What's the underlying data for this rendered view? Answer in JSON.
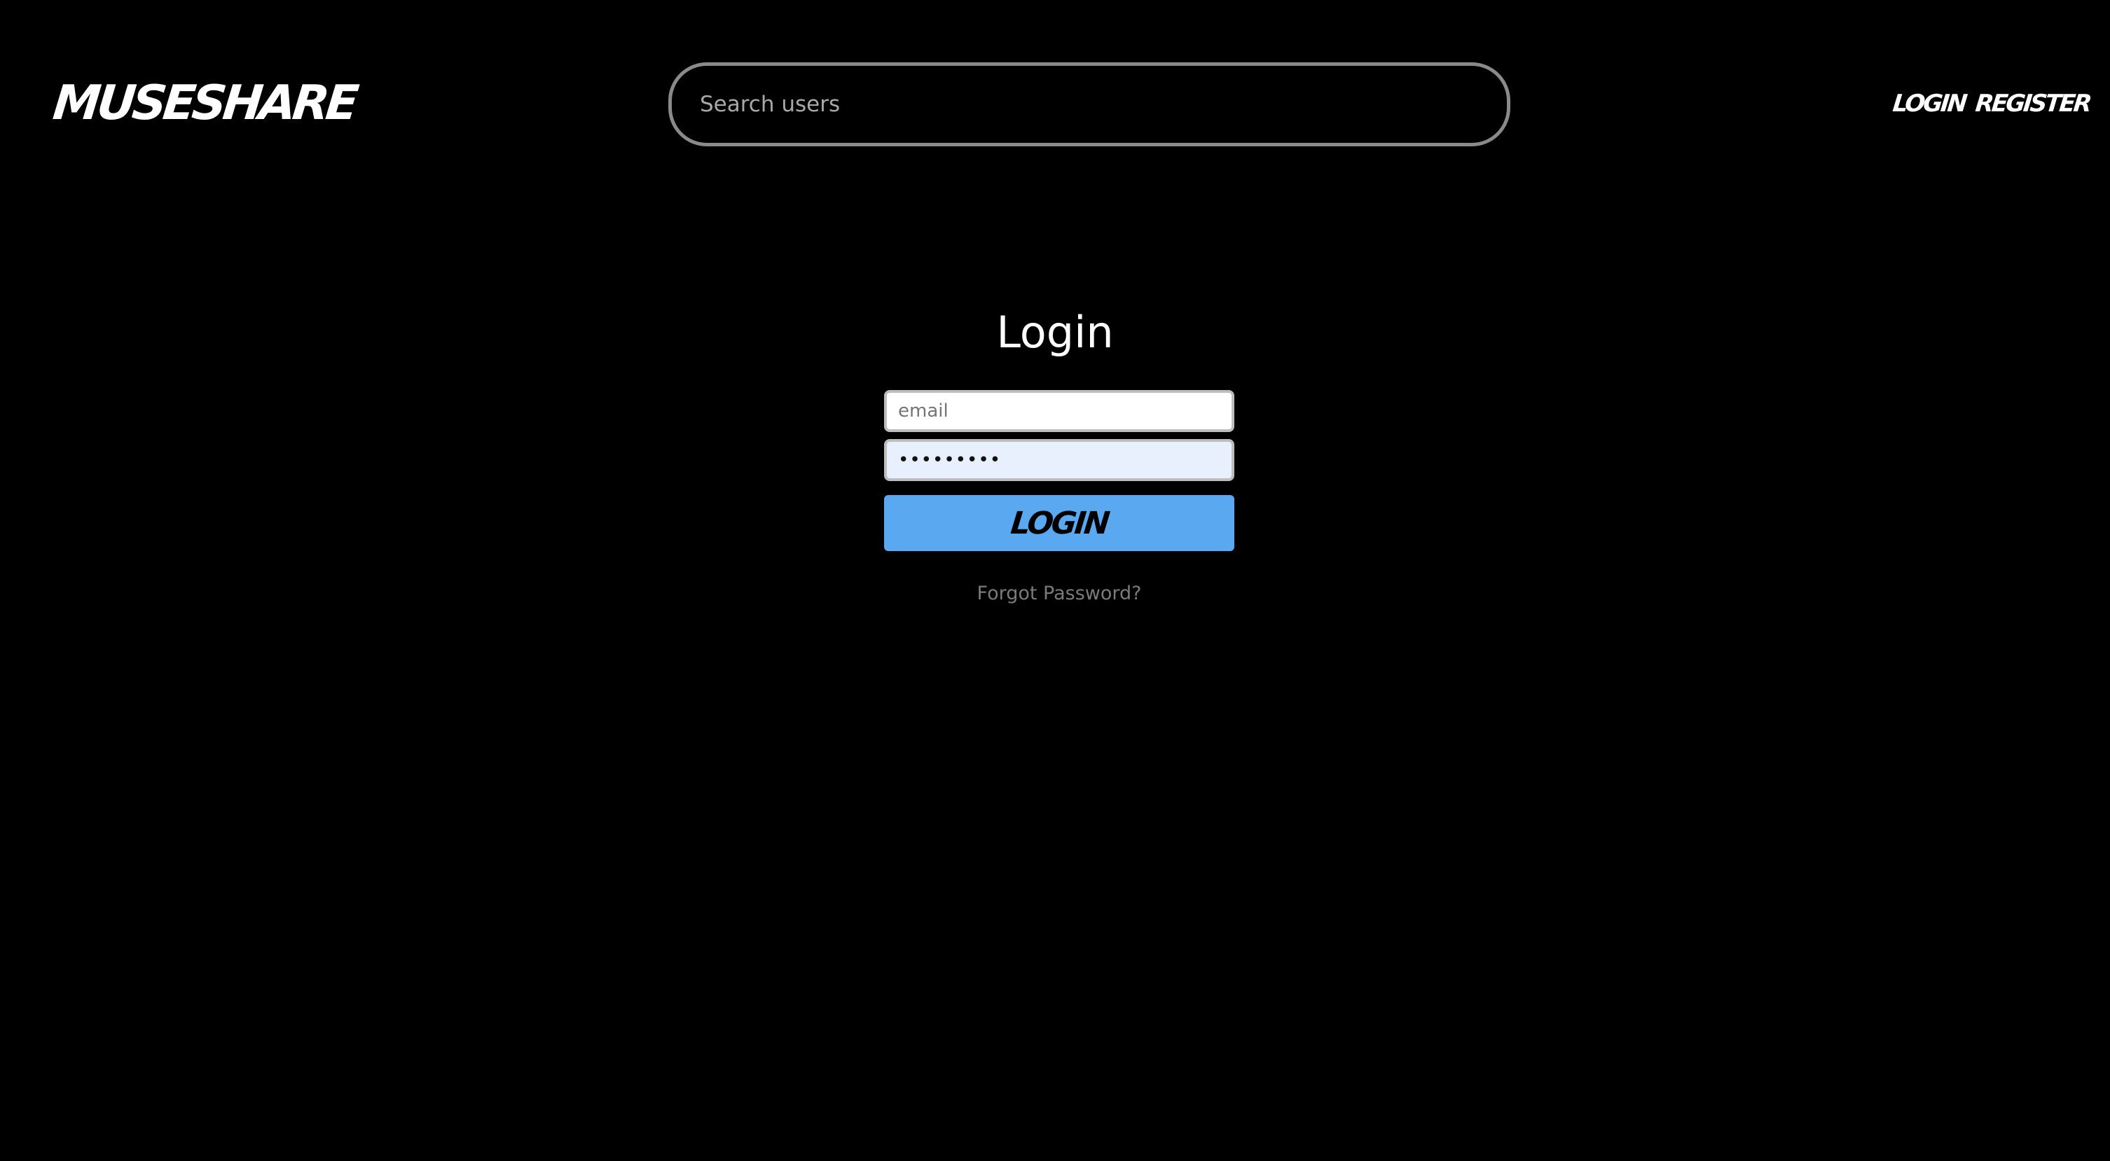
{
  "header": {
    "logo_text": "MUSESHARE",
    "search_placeholder": "Search users",
    "nav": {
      "login_label": "LOGIN",
      "register_label": "REGISTER"
    }
  },
  "login_form": {
    "title": "Login",
    "email_placeholder": "email",
    "email_value": "",
    "password_value": "•••••••••",
    "submit_label": "LOGIN",
    "forgot_password_label": "Forgot Password?"
  },
  "colors": {
    "background": "#000000",
    "accent_button": "#5aa9f0",
    "text_primary": "#ffffff",
    "text_muted": "#7a7a7a",
    "search_border": "#8a8a8a",
    "autofill_background": "#e8f0fe"
  }
}
